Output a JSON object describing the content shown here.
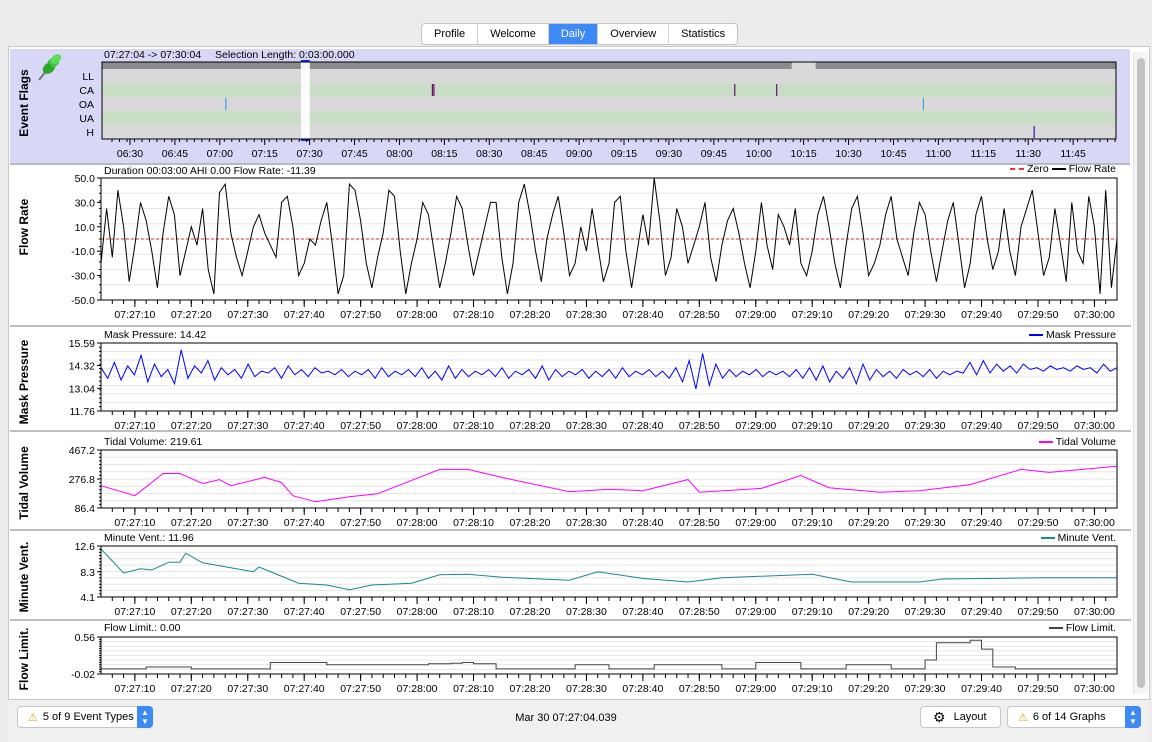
{
  "tabs": [
    {
      "label": "Profile",
      "active": false
    },
    {
      "label": "Welcome",
      "active": false
    },
    {
      "label": "Daily",
      "active": true
    },
    {
      "label": "Overview",
      "active": false
    },
    {
      "label": "Statistics",
      "active": false
    }
  ],
  "event_flags": {
    "title": "Event Flags",
    "range_text": "07:27:04 -> 07:30:04",
    "selection_text": "Selection Length: 0:03:00.000",
    "rows": [
      "LL",
      "CA",
      "OA",
      "UA",
      "H"
    ],
    "row_colors": [
      "#d9d9d9",
      "#c9ddc6"
    ],
    "time_ticks": [
      "06:30",
      "06:45",
      "07:00",
      "07:15",
      "07:30",
      "07:45",
      "08:00",
      "08:15",
      "08:30",
      "08:45",
      "09:00",
      "09:15",
      "09:30",
      "09:45",
      "10:00",
      "10:15",
      "10:30",
      "10:45",
      "11:00",
      "11:15",
      "11:30",
      "11:45"
    ],
    "selection": {
      "start": "07:27:04",
      "end": "07:30:04"
    },
    "data_gap": {
      "start": "10:11",
      "end": "10:19"
    },
    "events": [
      {
        "type": "CA",
        "time": "08:11",
        "color": "#6a0f6a"
      },
      {
        "type": "CA",
        "time": "08:11:30",
        "color": "#6a0f6a"
      },
      {
        "type": "CA",
        "time": "09:52",
        "color": "#6a0f6a"
      },
      {
        "type": "CA",
        "time": "10:06",
        "color": "#6a0f6a"
      },
      {
        "type": "OA",
        "time": "07:02",
        "color": "#3aa0e8"
      },
      {
        "type": "OA",
        "time": "10:55",
        "color": "#3aa0e8"
      },
      {
        "type": "H",
        "time": "11:32",
        "color": "#2020c0"
      }
    ]
  },
  "time_axis": {
    "start": "07:27:04",
    "end": "07:30:04",
    "ticks": [
      "07:27:10",
      "07:27:20",
      "07:27:30",
      "07:27:40",
      "07:27:50",
      "07:28:00",
      "07:28:10",
      "07:28:20",
      "07:28:30",
      "07:28:40",
      "07:28:50",
      "07:29:00",
      "07:29:10",
      "07:29:20",
      "07:29:30",
      "07:29:40",
      "07:29:50",
      "07:30:00"
    ]
  },
  "chart_data": [
    {
      "type": "line",
      "title": "Flow Rate",
      "header": "Duration 00:03:00 AHI 0.00 Flow Rate: -11.39",
      "legend": [
        "Zero",
        "Flow Rate"
      ],
      "ylim": [
        -50,
        50
      ],
      "yticks": [
        50,
        30,
        10,
        -10,
        -30,
        -50
      ],
      "ytick_labels": [
        "50.0",
        "30.0",
        "10.0",
        "-10.0",
        "-30.0",
        "-50.0"
      ],
      "zero_line": 0,
      "color": "#000000",
      "zero_color": "#e03030",
      "values": [
        -20,
        25,
        -15,
        40,
        10,
        -35,
        -5,
        30,
        15,
        -10,
        -40,
        5,
        35,
        20,
        -30,
        -10,
        10,
        -5,
        25,
        -25,
        -45,
        38,
        45,
        5,
        -15,
        -30,
        -10,
        10,
        20,
        5,
        -5,
        -15,
        30,
        35,
        10,
        -30,
        -20,
        0,
        -5,
        15,
        30,
        -5,
        -45,
        -30,
        45,
        40,
        15,
        -20,
        -40,
        -15,
        5,
        40,
        35,
        -10,
        -45,
        -20,
        0,
        30,
        20,
        -10,
        -40,
        -20,
        5,
        35,
        25,
        -5,
        -30,
        -10,
        10,
        30,
        30,
        -15,
        -45,
        -20,
        30,
        45,
        20,
        -10,
        -35,
        0,
        20,
        35,
        5,
        -30,
        -20,
        10,
        -10,
        25,
        -5,
        -35,
        -20,
        30,
        35,
        -10,
        -40,
        -10,
        20,
        -5,
        50,
        15,
        -30,
        -15,
        25,
        10,
        -20,
        -5,
        10,
        30,
        -15,
        -35,
        -5,
        15,
        25,
        5,
        -20,
        -40,
        -10,
        30,
        -5,
        -25,
        20,
        10,
        -5,
        25,
        -20,
        -30,
        -10,
        20,
        35,
        10,
        -20,
        -40,
        -5,
        25,
        35,
        5,
        -30,
        -20,
        -5,
        20,
        35,
        0,
        -15,
        -30,
        5,
        30,
        20,
        -10,
        -35,
        -10,
        15,
        30,
        -5,
        -40,
        -20,
        20,
        35,
        0,
        -25,
        -10,
        25,
        -10,
        -30,
        10,
        25,
        40,
        5,
        -30,
        -15,
        25,
        -5,
        -35,
        30,
        -10,
        -20,
        35,
        10,
        -45,
        40,
        -40,
        0
      ]
    },
    {
      "type": "line",
      "title": "Mask Pressure",
      "header": "Mask Pressure: 14.42",
      "legend": [
        "Mask Pressure"
      ],
      "ylim": [
        11.76,
        15.59
      ],
      "yticks": [
        15.59,
        14.32,
        13.04,
        11.76
      ],
      "ytick_labels": [
        "15.59",
        "14.32",
        "13.04",
        "11.76"
      ],
      "color": "#0000ff",
      "values": [
        14.2,
        13.6,
        14.5,
        13.5,
        14.3,
        13.8,
        14.9,
        13.4,
        14.4,
        13.7,
        14.1,
        13.3,
        15.2,
        13.6,
        14.3,
        13.9,
        14.6,
        13.5,
        14.2,
        13.8,
        14.1,
        13.6,
        14.4,
        13.7,
        14.0,
        13.9,
        14.2,
        13.6,
        14.3,
        13.8,
        14.1,
        13.7,
        14.2,
        13.9,
        14.0,
        13.8,
        14.1,
        13.7,
        14.0,
        13.8,
        14.1,
        13.6,
        14.2,
        13.7,
        14.0,
        13.8,
        14.1,
        13.7,
        14.2,
        13.6,
        14.0,
        13.5,
        14.3,
        13.6,
        14.1,
        13.7,
        14.0,
        13.8,
        14.1,
        13.7,
        14.2,
        13.6,
        14.0,
        13.8,
        14.1,
        13.6,
        14.3,
        13.5,
        14.1,
        13.7,
        14.0,
        13.8,
        14.1,
        13.6,
        14.0,
        13.7,
        14.1,
        13.6,
        14.2,
        13.7,
        14.0,
        13.8,
        14.1,
        13.7,
        14.0,
        13.6,
        14.2,
        13.4,
        14.6,
        13.0,
        15.0,
        13.2,
        14.4,
        13.6,
        14.1,
        13.7,
        14.0,
        13.8,
        14.1,
        13.7,
        14.0,
        13.8,
        14.0,
        13.7,
        14.1,
        13.6,
        14.2,
        13.5,
        14.3,
        13.4,
        14.0,
        13.6,
        14.2,
        13.3,
        14.4,
        13.5,
        14.1,
        13.7,
        14.0,
        13.6,
        14.1,
        13.8,
        14.0,
        13.7,
        14.1,
        13.6,
        14.0,
        13.8,
        14.0,
        13.9,
        14.5,
        13.8,
        14.6,
        13.9,
        14.4,
        14.0,
        14.3,
        13.9,
        14.4,
        14.1,
        14.2,
        14.0,
        14.3,
        14.1,
        14.2,
        14.0,
        14.3,
        14.1,
        14.2,
        13.9,
        14.4,
        14.0,
        14.2
      ]
    },
    {
      "type": "line",
      "title": "Tidal Volume",
      "header": "Tidal Volume: 219.61",
      "legend": [
        "Tidal Volume"
      ],
      "ylim": [
        86.4,
        467.2
      ],
      "yticks": [
        467.2,
        276.8,
        86.4
      ],
      "ytick_labels": [
        "467.2",
        "276.8",
        "86.4"
      ],
      "color": "#ff00ff",
      "points": [
        [
          "07:27:04",
          233
        ],
        [
          "07:27:10",
          167
        ],
        [
          "07:27:15",
          313
        ],
        [
          "07:27:18",
          313
        ],
        [
          "07:27:22",
          247
        ],
        [
          "07:27:25",
          273
        ],
        [
          "07:27:27",
          233
        ],
        [
          "07:27:33",
          287
        ],
        [
          "07:27:36",
          253
        ],
        [
          "07:27:38",
          167
        ],
        [
          "07:27:42",
          127
        ],
        [
          "07:27:48",
          160
        ],
        [
          "07:27:53",
          180
        ],
        [
          "07:28:04",
          340
        ],
        [
          "07:28:09",
          340
        ],
        [
          "07:28:15",
          287
        ],
        [
          "07:28:27",
          193
        ],
        [
          "07:28:34",
          210
        ],
        [
          "07:28:40",
          200
        ],
        [
          "07:28:48",
          273
        ],
        [
          "07:28:50",
          190
        ],
        [
          "07:29:01",
          215
        ],
        [
          "07:29:08",
          300
        ],
        [
          "07:29:13",
          220
        ],
        [
          "07:29:22",
          190
        ],
        [
          "07:29:29",
          200
        ],
        [
          "07:29:38",
          240
        ],
        [
          "07:29:47",
          340
        ],
        [
          "07:29:52",
          320
        ],
        [
          "07:30:04",
          360
        ]
      ]
    },
    {
      "type": "line",
      "title": "Minute Vent.",
      "header": "Minute Vent.: 11.96",
      "legend": [
        "Minute Vent."
      ],
      "ylim": [
        4.1,
        12.6
      ],
      "yticks": [
        12.6,
        8.3,
        4.1
      ],
      "ytick_labels": [
        "12.6",
        "8.3",
        "4.1"
      ],
      "color": "#1a8a8a",
      "points": [
        [
          "07:27:04",
          12.1
        ],
        [
          "07:27:08",
          8.1
        ],
        [
          "07:27:11",
          8.8
        ],
        [
          "07:27:13",
          8.6
        ],
        [
          "07:27:16",
          9.9
        ],
        [
          "07:27:18",
          9.9
        ],
        [
          "07:27:19",
          11.4
        ],
        [
          "07:27:22",
          9.8
        ],
        [
          "07:27:28",
          8.8
        ],
        [
          "07:27:31",
          8.3
        ],
        [
          "07:27:32",
          9.1
        ],
        [
          "07:27:39",
          6.4
        ],
        [
          "07:27:44",
          6.1
        ],
        [
          "07:27:48",
          5.3
        ],
        [
          "07:27:52",
          6.1
        ],
        [
          "07:27:59",
          6.4
        ],
        [
          "07:28:04",
          7.8
        ],
        [
          "07:28:09",
          7.9
        ],
        [
          "07:28:15",
          7.4
        ],
        [
          "07:28:27",
          6.9
        ],
        [
          "07:28:32",
          8.3
        ],
        [
          "07:28:40",
          7.2
        ],
        [
          "07:28:48",
          6.6
        ],
        [
          "07:28:54",
          7.3
        ],
        [
          "07:29:10",
          7.9
        ],
        [
          "07:29:17",
          6.6
        ],
        [
          "07:29:29",
          6.6
        ],
        [
          "07:29:33",
          7.1
        ],
        [
          "07:29:51",
          7.3
        ],
        [
          "07:30:04",
          7.3
        ]
      ]
    },
    {
      "type": "line",
      "title": "Flow Limit.",
      "header": "Flow Limit.: 0.00",
      "legend": [
        "Flow Limit."
      ],
      "ylim": [
        -0.02,
        0.56
      ],
      "yticks": [
        0.56,
        -0.02
      ],
      "ytick_labels": [
        "0.56",
        "-0.02"
      ],
      "color": "#444444",
      "step": true,
      "points": [
        [
          "07:27:04",
          0.06
        ],
        [
          "07:27:12",
          0.09
        ],
        [
          "07:27:20",
          0.06
        ],
        [
          "07:27:34",
          0.16
        ],
        [
          "07:27:44",
          0.125
        ],
        [
          "07:28:02",
          0.14
        ],
        [
          "07:28:06",
          0.15
        ],
        [
          "07:28:08",
          0.16
        ],
        [
          "07:28:10",
          0.14
        ],
        [
          "07:28:14",
          0.06
        ],
        [
          "07:28:28",
          0.125
        ],
        [
          "07:28:34",
          0.06
        ],
        [
          "07:28:42",
          0.125
        ],
        [
          "07:28:54",
          0.06
        ],
        [
          "07:29:00",
          0.16
        ],
        [
          "07:29:08",
          0.06
        ],
        [
          "07:29:16",
          0.125
        ],
        [
          "07:29:24",
          0.06
        ],
        [
          "07:29:30",
          0.2
        ],
        [
          "07:29:32",
          0.47
        ],
        [
          "07:29:38",
          0.51
        ],
        [
          "07:29:40",
          0.37
        ],
        [
          "07:29:42",
          0.09
        ],
        [
          "07:29:46",
          0.06
        ],
        [
          "07:30:04",
          0.06
        ]
      ]
    }
  ],
  "bottom_bar": {
    "event_types_label": "5 of 9 Event Types",
    "date_time": "Mar 30 07:27:04.039",
    "layout_label": "Layout",
    "graphs_label": "6 of 14 Graphs"
  }
}
